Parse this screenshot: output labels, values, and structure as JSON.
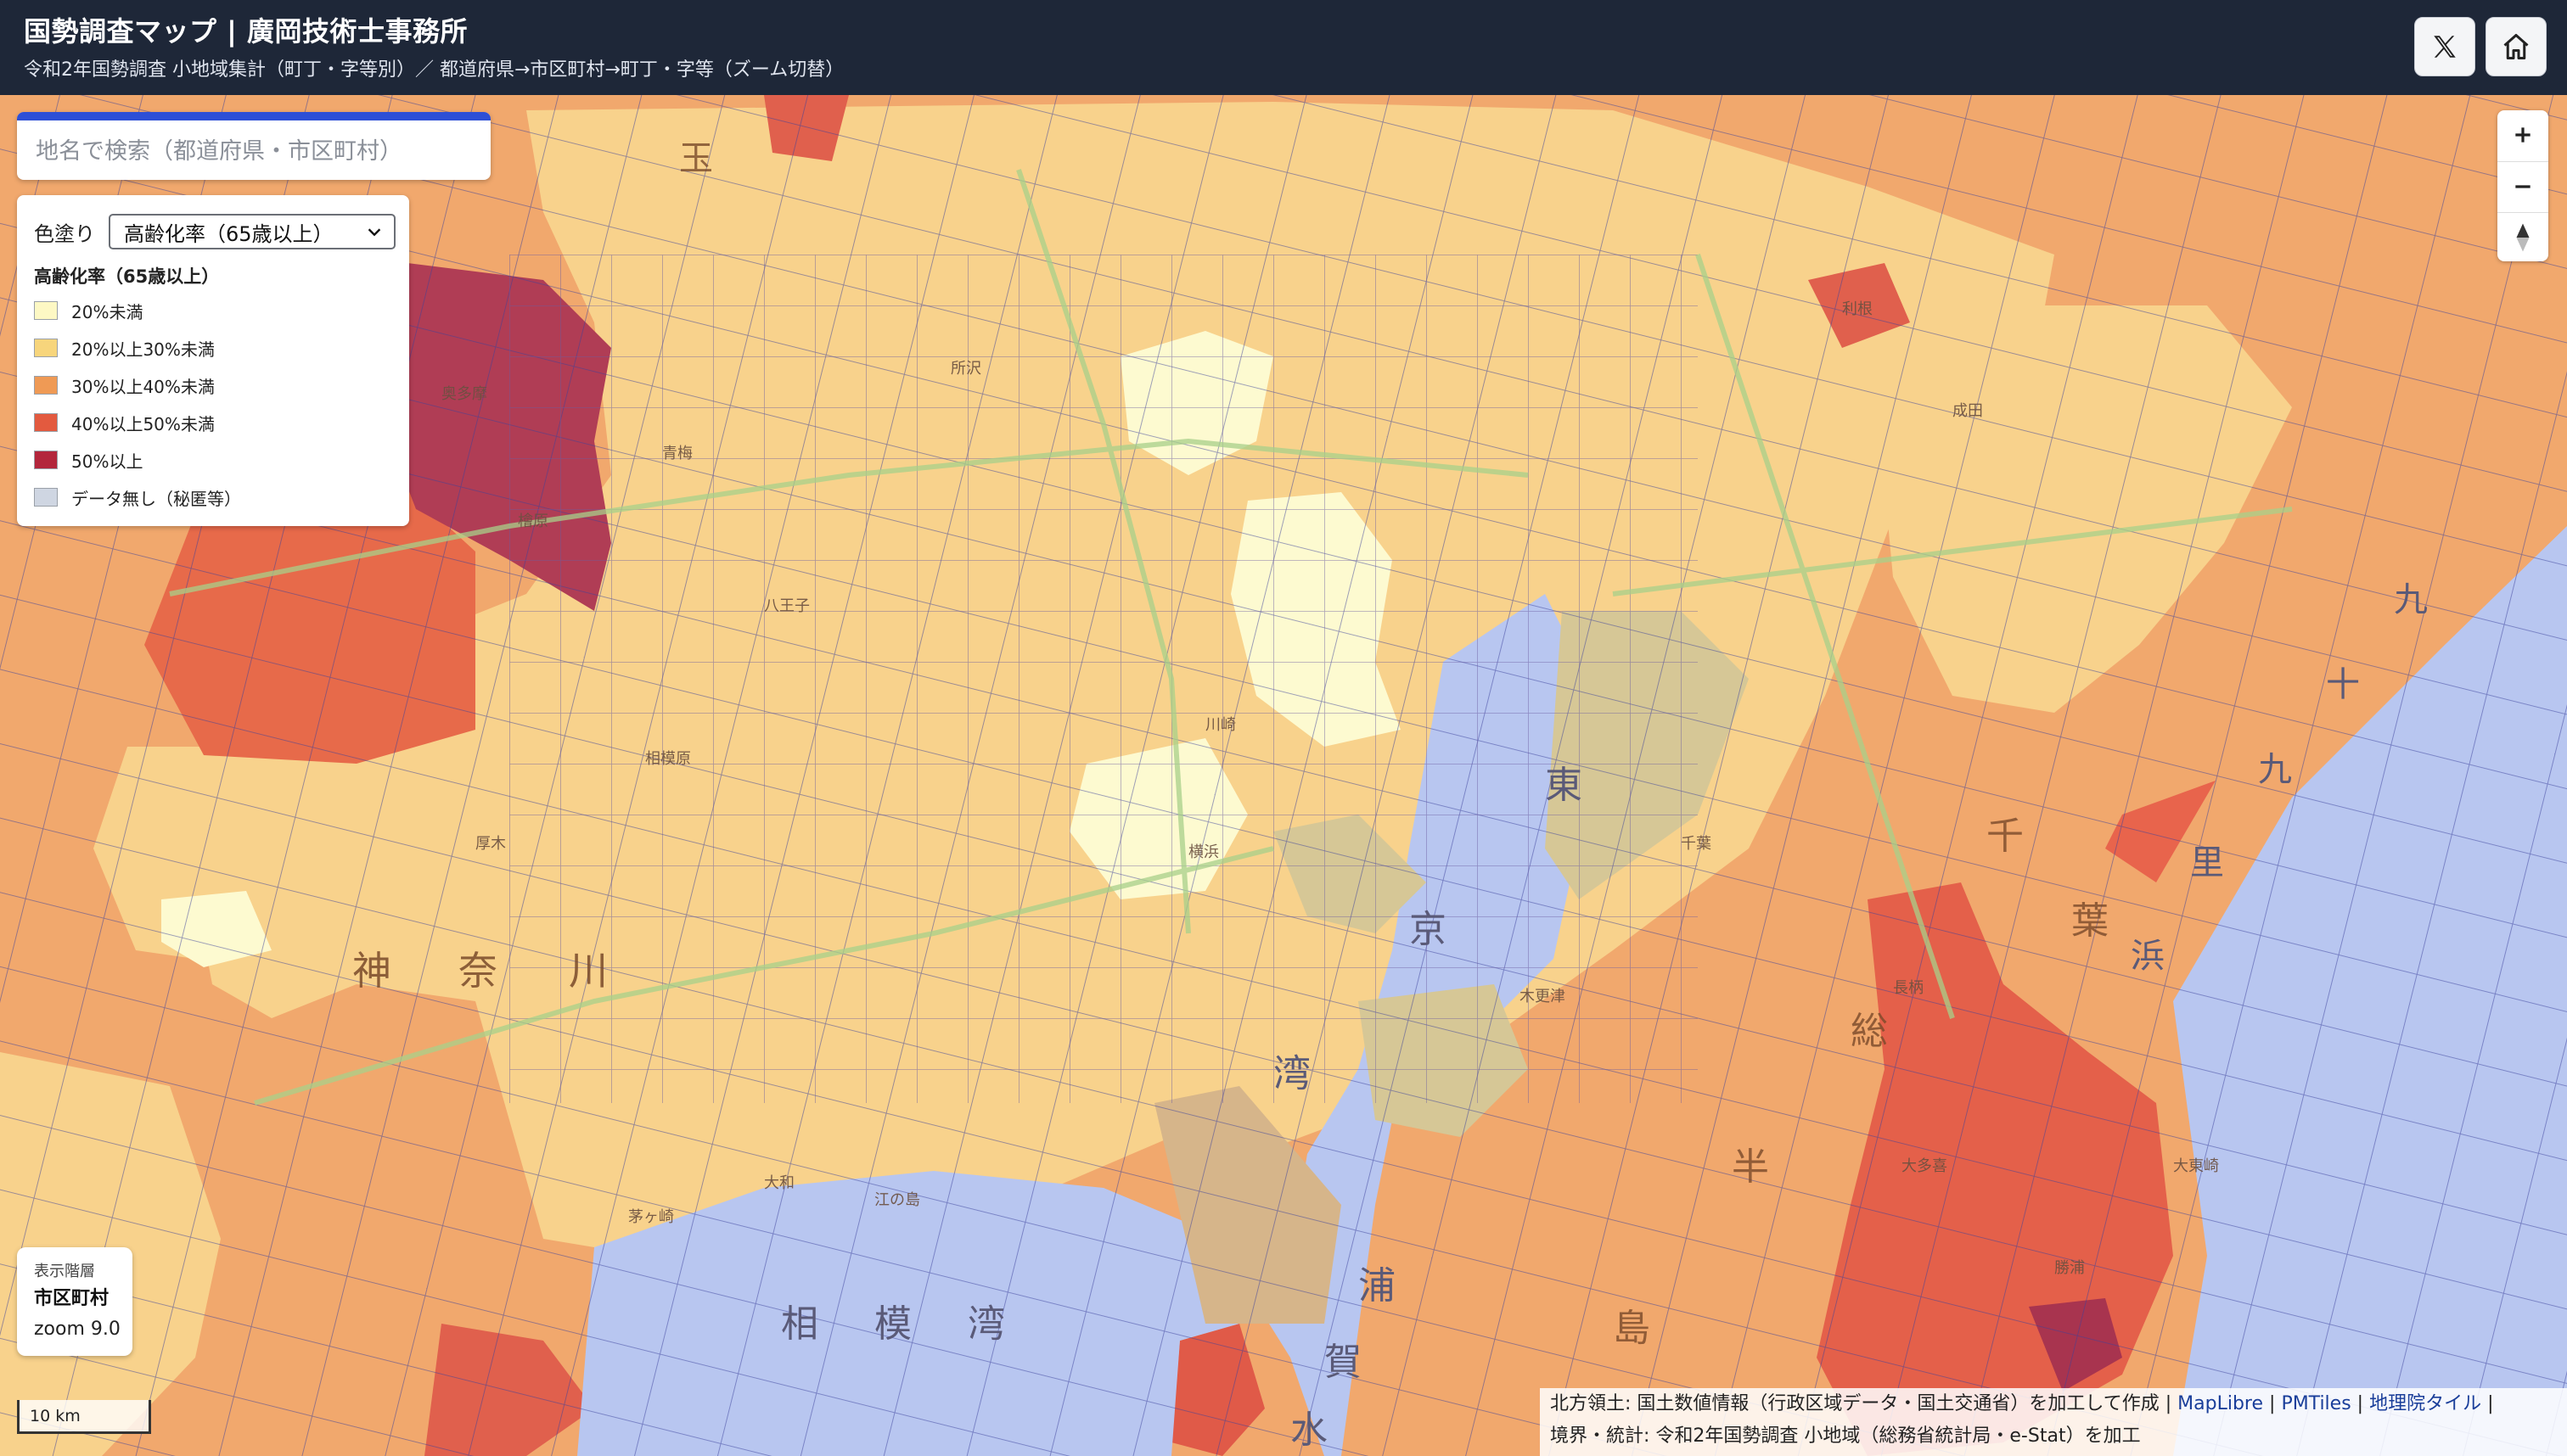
{
  "header": {
    "title": "国勢調査マップ | 廣岡技術士事務所",
    "subtitle": "令和2年国勢調査 小地域集計（町丁・字等別）／ 都道府県→市区町村→町丁・字等（ズーム切替）",
    "x_icon": "x-logo-icon",
    "home_icon": "home-icon"
  },
  "search": {
    "placeholder": "地名で検索（都道府県・市区町村）"
  },
  "legend": {
    "color_label": "色塗り",
    "selected": "高齢化率（65歳以上）",
    "title": "高齢化率（65歳以上）",
    "items": [
      {
        "label": "20%未満",
        "color": "#fdf8c4"
      },
      {
        "label": "20%以上30%未満",
        "color": "#f7d57c"
      },
      {
        "label": "30%以上40%未満",
        "color": "#ef9a55"
      },
      {
        "label": "40%以上50%未満",
        "color": "#e35a3f"
      },
      {
        "label": "50%以上",
        "color": "#b3263c"
      },
      {
        "label": "データ無し（秘匿等）",
        "color": "#cfd6e2"
      }
    ]
  },
  "map_labels": {
    "kanagawa": [
      "神",
      "奈",
      "川"
    ],
    "sagami_bay": [
      "相",
      "模",
      "湾"
    ],
    "tokyo_bay": [
      "東",
      "京",
      "湾"
    ],
    "uraga": [
      "浦",
      "賀",
      "水"
    ],
    "chiba": [
      "千",
      "葉"
    ],
    "boso": [
      "総",
      "半",
      "島"
    ],
    "kujukuri": [
      "九",
      "十",
      "九",
      "里",
      "浜"
    ],
    "saitama": [
      "玉"
    ],
    "places": [
      "奥多摩",
      "檜原",
      "大和",
      "江の島",
      "茅ヶ崎",
      "相模原",
      "成田",
      "千葉",
      "木更津",
      "長柄",
      "大多喜",
      "勝浦",
      "大東崎",
      "利根",
      "厚木",
      "横浜",
      "川崎",
      "八王子",
      "青梅",
      "所沢"
    ]
  },
  "controls": {
    "zoom_in": "+",
    "zoom_out": "−",
    "compass": "compass-icon"
  },
  "zoom_info": {
    "label": "表示階層",
    "level": "市区町村",
    "zoom": "zoom 9.0"
  },
  "scale": {
    "label": "10 km"
  },
  "attribution": {
    "line1_prefix": "北方領土: 国土数値情報（行政区域データ・国土交通省）を加工して作成 |",
    "link1": "MapLibre",
    "sep1": "|",
    "link2": "PMTiles",
    "sep2": "|",
    "link3": "地理院タイル",
    "sep3": "|",
    "line2": "境界・統計: 令和2年国勢調査 小地域（総務省統計局・e-Stat）を加工"
  }
}
